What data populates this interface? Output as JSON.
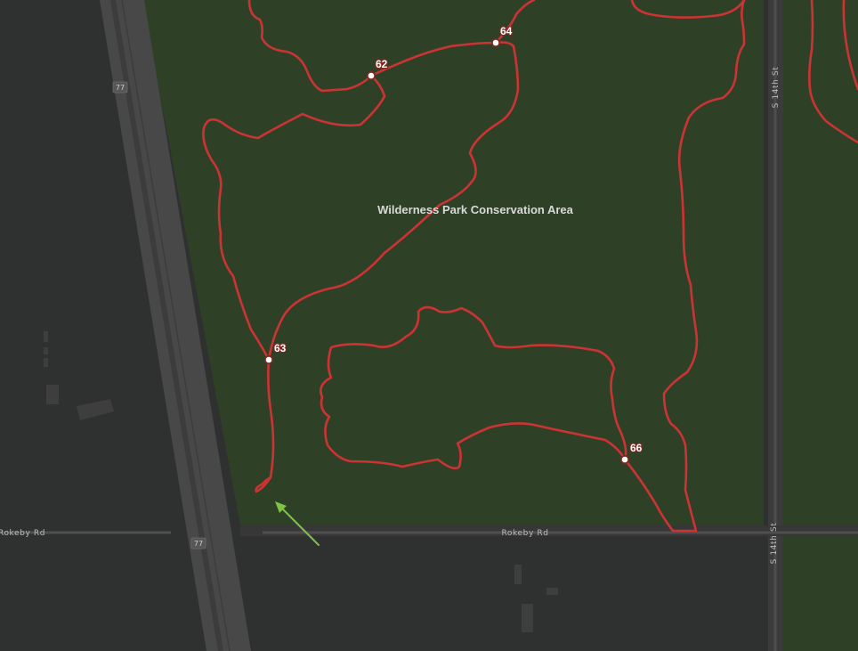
{
  "map": {
    "park_name": "Wilderness Park Conservation Area",
    "colors": {
      "background": "#2f3030",
      "park": "#2e4127",
      "trail": "#cc3333",
      "highway": "#474847",
      "road": "#4a4b4a",
      "arrow": "#7ec242"
    },
    "roads": {
      "rokeby_left": "Rokeby Rd",
      "rokeby_center": "Rokeby Rd",
      "s14th_top": "S 14th St",
      "s14th_bottom": "S 14th St"
    },
    "highway_shields": {
      "top": "77",
      "bottom": "77"
    },
    "waypoints": [
      {
        "id": "62",
        "label": "62"
      },
      {
        "id": "64",
        "label": "64"
      },
      {
        "id": "63",
        "label": "63"
      },
      {
        "id": "66",
        "label": "66"
      }
    ],
    "icons": [
      "direction-arrow-icon",
      "waypoint-marker-icon",
      "highway-shield-icon"
    ]
  }
}
